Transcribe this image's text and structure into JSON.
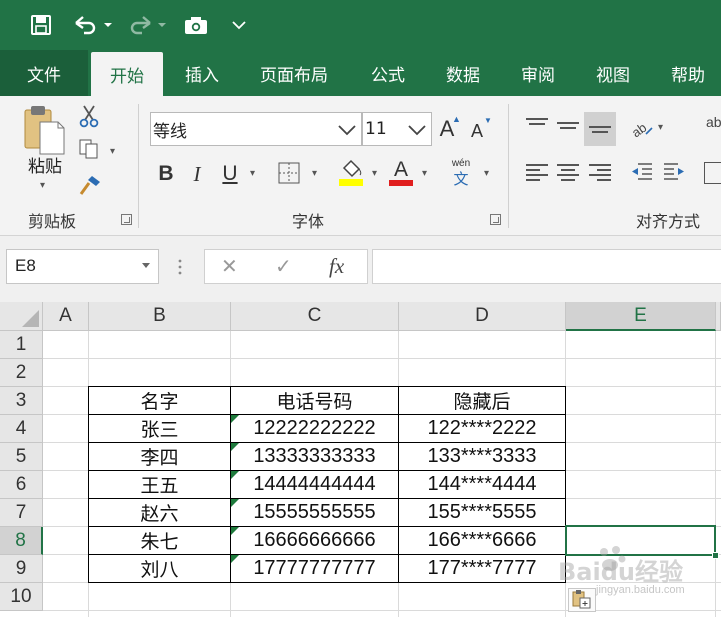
{
  "colors": {
    "brand": "#217346",
    "selection": "#217346",
    "error_indicator": "#1e7a3c"
  },
  "quick_access": {
    "icons": [
      "save-icon",
      "undo-icon",
      "redo-icon",
      "camera-icon",
      "customize-icon"
    ]
  },
  "tabs": [
    {
      "label": "文件"
    },
    {
      "label": "开始"
    },
    {
      "label": "插入"
    },
    {
      "label": "页面布局"
    },
    {
      "label": "公式"
    },
    {
      "label": "数据"
    },
    {
      "label": "审阅"
    },
    {
      "label": "视图"
    },
    {
      "label": "帮助"
    }
  ],
  "active_tab": "开始",
  "ribbon": {
    "clipboard": {
      "paste_label": "粘贴",
      "group_label": "剪贴板"
    },
    "font": {
      "group_label": "字体",
      "font_name": "等线",
      "font_size": "11",
      "grow_label": "A",
      "shrink_label": "A",
      "bold": "B",
      "italic": "I",
      "underline": "U",
      "font_color_label": "A",
      "phonetic_top": "wén",
      "phonetic_bottom": "文"
    },
    "alignment": {
      "group_label": "对齐方式"
    }
  },
  "formula_bar": {
    "name_box": "E8",
    "cancel_icon": "✕",
    "enter_icon": "✓",
    "fx_label": "fx",
    "formula": ""
  },
  "sheet": {
    "columns": [
      "A",
      "B",
      "C",
      "D",
      "E"
    ],
    "selected_column": "E",
    "rows": [
      "1",
      "2",
      "3",
      "4",
      "5",
      "6",
      "7",
      "8",
      "9",
      "10"
    ],
    "selected_row": "8",
    "selected_cell": "E8",
    "table": {
      "headers": [
        "名字",
        "电话号码",
        "隐藏后"
      ],
      "rows": [
        [
          "张三",
          "12222222222",
          "122****2222"
        ],
        [
          "李四",
          "13333333333",
          "133****3333"
        ],
        [
          "王五",
          "14444444444",
          "144****4444"
        ],
        [
          "赵六",
          "15555555555",
          "155****5555"
        ],
        [
          "朱七",
          "16666666666",
          "166****6666"
        ],
        [
          "刘八",
          "17777777777",
          "177****7777"
        ]
      ]
    }
  },
  "watermark": {
    "text": "Baidu经验",
    "sub": "jingyan.baidu.com"
  }
}
